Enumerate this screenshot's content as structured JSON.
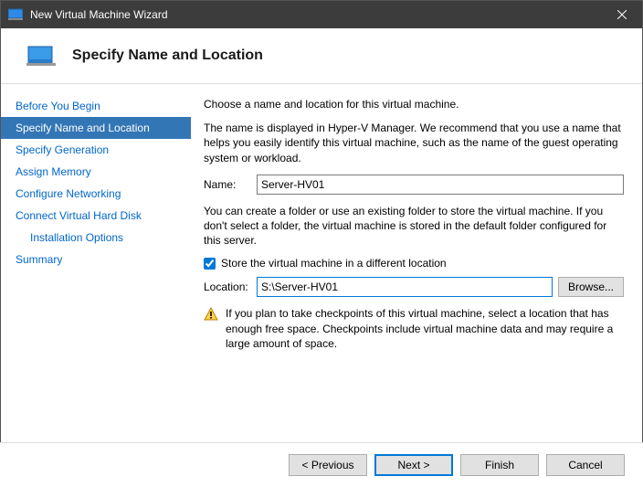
{
  "window": {
    "title": "New Virtual Machine Wizard"
  },
  "header": {
    "title": "Specify Name and Location"
  },
  "sidebar": {
    "items": [
      {
        "label": "Before You Begin",
        "selected": false,
        "sub": false
      },
      {
        "label": "Specify Name and Location",
        "selected": true,
        "sub": false
      },
      {
        "label": "Specify Generation",
        "selected": false,
        "sub": false
      },
      {
        "label": "Assign Memory",
        "selected": false,
        "sub": false
      },
      {
        "label": "Configure Networking",
        "selected": false,
        "sub": false
      },
      {
        "label": "Connect Virtual Hard Disk",
        "selected": false,
        "sub": false
      },
      {
        "label": "Installation Options",
        "selected": false,
        "sub": true
      },
      {
        "label": "Summary",
        "selected": false,
        "sub": false
      }
    ]
  },
  "content": {
    "intro": "Choose a name and location for this virtual machine.",
    "name_desc": "The name is displayed in Hyper-V Manager. We recommend that you use a name that helps you easily identify this virtual machine, such as the name of the guest operating system or workload.",
    "name_label": "Name:",
    "name_value": "Server-HV01",
    "loc_desc": "You can create a folder or use an existing folder to store the virtual machine. If you don't select a folder, the virtual machine is stored in the default folder configured for this server.",
    "store_checkbox_label": "Store the virtual machine in a different location",
    "store_checked": true,
    "location_label": "Location:",
    "location_value": "S:\\Server-HV01",
    "browse_label": "Browse...",
    "warning": "If you plan to take checkpoints of this virtual machine, select a location that has enough free space. Checkpoints include virtual machine data and may require a large amount of space."
  },
  "footer": {
    "previous": "< Previous",
    "next": "Next >",
    "finish": "Finish",
    "cancel": "Cancel"
  }
}
